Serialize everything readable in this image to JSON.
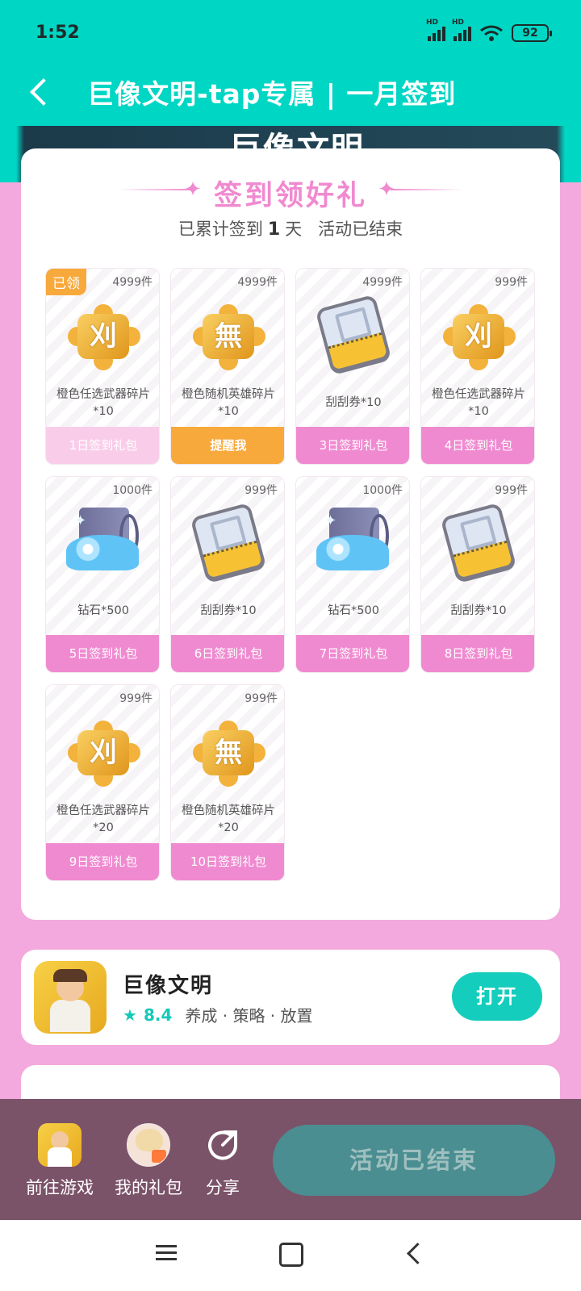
{
  "status": {
    "time": "1:52",
    "hd": "HD",
    "battery": "92"
  },
  "header": {
    "title": "巨像文明-tap专属 | 一月签到"
  },
  "banner": {
    "logo": "巨像文明"
  },
  "signin": {
    "title": "签到领好礼",
    "sub_prefix": "已累计签到",
    "count": "1",
    "sub_unit": "天",
    "status": "活动已结束",
    "gifts": [
      {
        "qty": "4999件",
        "icon": "puzzle-weapon",
        "glyph": "刈",
        "name": "橙色任选武器碎片*10",
        "button": "1日签到礼包",
        "claimed": "已领",
        "state": "past"
      },
      {
        "qty": "4999件",
        "icon": "puzzle-hero",
        "glyph": "無",
        "name": "橙色随机英雄碎片*10",
        "button": "提醒我",
        "state": "remind"
      },
      {
        "qty": "4999件",
        "icon": "scratch-ticket",
        "name": "刮刮券*10",
        "button": "3日签到礼包",
        "state": "normal"
      },
      {
        "qty": "999件",
        "icon": "puzzle-weapon",
        "glyph": "刈",
        "name": "橙色任选武器碎片*10",
        "button": "4日签到礼包",
        "state": "normal"
      },
      {
        "qty": "1000件",
        "icon": "diamond-safe",
        "name": "钻石*500",
        "button": "5日签到礼包",
        "state": "normal"
      },
      {
        "qty": "999件",
        "icon": "scratch-ticket",
        "name": "刮刮券*10",
        "button": "6日签到礼包",
        "state": "normal"
      },
      {
        "qty": "1000件",
        "icon": "diamond-safe",
        "name": "钻石*500",
        "button": "7日签到礼包",
        "state": "normal"
      },
      {
        "qty": "999件",
        "icon": "scratch-ticket",
        "name": "刮刮券*10",
        "button": "8日签到礼包",
        "state": "normal"
      },
      {
        "qty": "999件",
        "icon": "puzzle-weapon",
        "glyph": "刈",
        "name": "橙色任选武器碎片*20",
        "button": "9日签到礼包",
        "state": "normal"
      },
      {
        "qty": "999件",
        "icon": "puzzle-hero",
        "glyph": "無",
        "name": "橙色随机英雄碎片*20",
        "button": "10日签到礼包",
        "state": "normal"
      }
    ]
  },
  "game": {
    "name": "巨像文明",
    "rating": "8.4",
    "tags": "养成 · 策略 · 放置",
    "open_label": "打开"
  },
  "actions": {
    "play": "前往游戏",
    "gifts": "我的礼包",
    "share": "分享",
    "ended": "活动已结束"
  },
  "colors": {
    "teal": "#00d6c4",
    "pink": "#f08ad0",
    "orange": "#f8a93c",
    "bar": "#7b5369"
  }
}
